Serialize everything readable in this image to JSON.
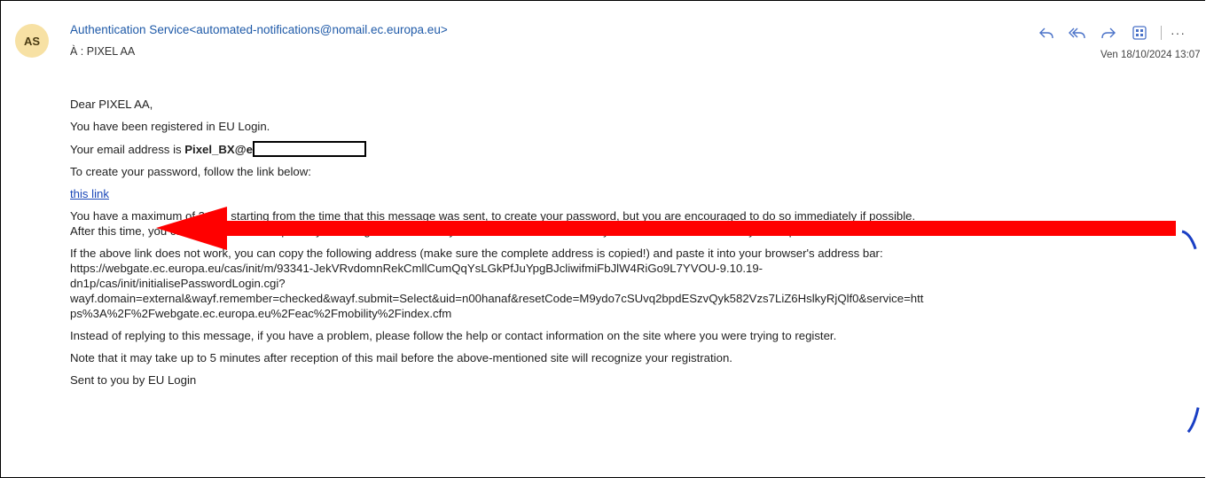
{
  "header": {
    "avatar_initials": "AS",
    "sender": "Authentication Service<automated-notifications@nomail.ec.europa.eu>",
    "to_line": "À : PIXEL AA",
    "date": "Ven 18/10/2024 13:07",
    "actions": [
      {
        "icon": "reply-icon"
      },
      {
        "icon": "reply-all-icon"
      },
      {
        "icon": "forward-icon"
      },
      {
        "icon": "apps-icon"
      },
      {
        "icon": "more-icon",
        "label": "···"
      }
    ]
  },
  "body": {
    "greeting": "Dear PIXEL AA,",
    "registered": "You have been registered in EU Login.",
    "email_prefix": "Your email address is ",
    "email_value": "Pixel_BX@e",
    "create_instruction": "To create your password, follow the link below:",
    "link_text": "this link",
    "max_line1": "You have a maximum of 24 hr, starting from the time that this message was sent, to create your password, but you are encouraged to do so immediately if possible.",
    "max_line2": "After this time, you can make another request by following the same link: you will then need to re-enter your username and confirm your request.",
    "copy_line": "If the above link does not work, you can copy the following address (make sure the complete address is copied!) and paste it into your browser's address bar:",
    "url_line1": "https://webgate.ec.europa.eu/cas/init/m/93341-JekVRvdomnRekCmllCumQqYsLGkPfJuYpgBJcliwifmiFbJlW4RiGo9L7YVOU-9.10.19-",
    "url_line2": "dn1p/cas/init/initialisePasswordLogin.cgi?",
    "url_line3": "wayf.domain=external&wayf.remember=checked&wayf.submit=Select&uid=n00hanaf&resetCode=M9ydo7cSUvq2bpdESzvQyk582Vzs7LiZ6HslkyRjQlf0&service=htt",
    "url_line4": "ps%3A%2F%2Fwebgate.ec.europa.eu%2Feac%2Fmobility%2Findex.cfm",
    "help_line": "Instead of replying to this message, if you have a problem, please follow the help or contact information on the site where you were trying to register.",
    "note_line": "Note that it may take up to 5 minutes after reception of this mail before the above-mentioned site will recognize your registration.",
    "sent_by": "Sent to you by EU Login"
  },
  "annotations": {
    "arrow_color": "#ff0000",
    "arc_color": "#1a3fc4"
  }
}
